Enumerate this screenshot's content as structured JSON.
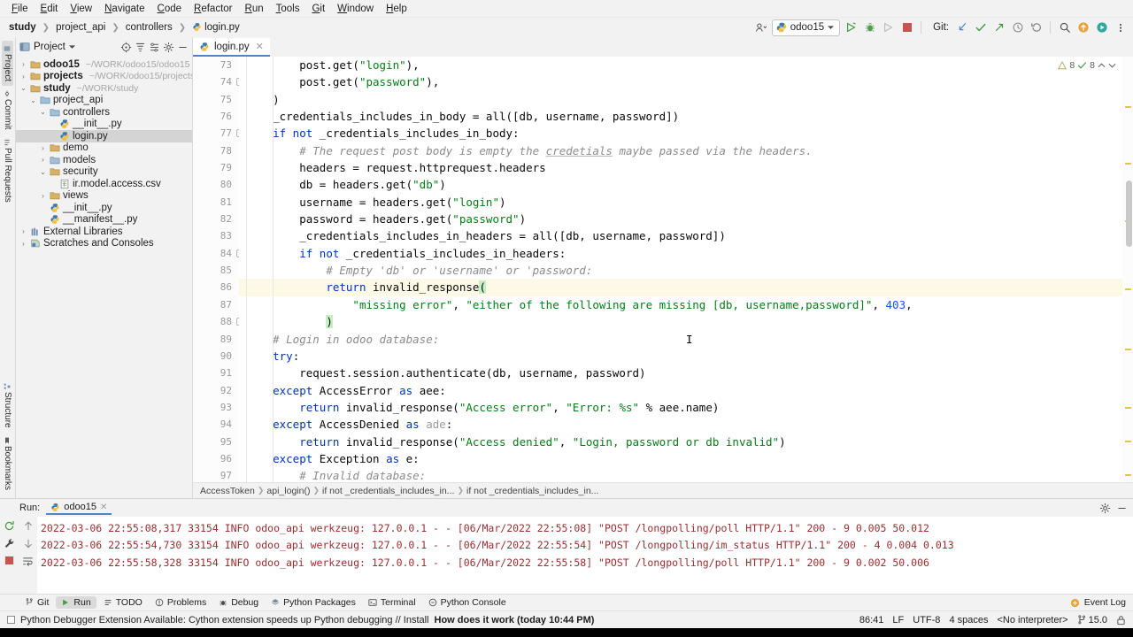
{
  "menu": {
    "items": [
      "File",
      "Edit",
      "View",
      "Navigate",
      "Code",
      "Refactor",
      "Run",
      "Tools",
      "Git",
      "Window",
      "Help"
    ]
  },
  "navbar": {
    "breadcrumbs": [
      "study",
      "project_api",
      "controllers",
      "login.py"
    ],
    "run_config": "odoo15",
    "git_label": "Git:"
  },
  "project_panel": {
    "title": "Project",
    "tree": [
      {
        "indent": 0,
        "arrow": "›",
        "label": "odoo15",
        "bold": true,
        "path": "~/WORK/odoo15/odoo15",
        "icon": "folder-icon",
        "selected": false
      },
      {
        "indent": 0,
        "arrow": "›",
        "label": "projects",
        "bold": true,
        "path": "~/WORK/odoo15/projects",
        "icon": "folder-icon",
        "selected": false
      },
      {
        "indent": 0,
        "arrow": "⌄",
        "label": "study",
        "bold": true,
        "path": "~/WORK/study",
        "icon": "folder-icon",
        "selected": false
      },
      {
        "indent": 1,
        "arrow": "⌄",
        "label": "project_api",
        "bold": false,
        "path": "",
        "icon": "module-folder-icon",
        "selected": false
      },
      {
        "indent": 2,
        "arrow": "⌄",
        "label": "controllers",
        "bold": false,
        "path": "",
        "icon": "module-folder-icon",
        "selected": false
      },
      {
        "indent": 3,
        "arrow": "",
        "label": "__init__.py",
        "bold": false,
        "path": "",
        "icon": "python-file-icon",
        "selected": false
      },
      {
        "indent": 3,
        "arrow": "",
        "label": "login.py",
        "bold": false,
        "path": "",
        "icon": "python-file-icon",
        "selected": true
      },
      {
        "indent": 2,
        "arrow": "›",
        "label": "demo",
        "bold": false,
        "path": "",
        "icon": "folder-icon",
        "selected": false
      },
      {
        "indent": 2,
        "arrow": "›",
        "label": "models",
        "bold": false,
        "path": "",
        "icon": "module-folder-icon",
        "selected": false
      },
      {
        "indent": 2,
        "arrow": "⌄",
        "label": "security",
        "bold": false,
        "path": "",
        "icon": "folder-icon",
        "selected": false
      },
      {
        "indent": 3,
        "arrow": "",
        "label": "ir.model.access.csv",
        "bold": false,
        "path": "",
        "icon": "csv-file-icon",
        "selected": false
      },
      {
        "indent": 2,
        "arrow": "›",
        "label": "views",
        "bold": false,
        "path": "",
        "icon": "folder-icon",
        "selected": false
      },
      {
        "indent": 2,
        "arrow": "",
        "label": "__init__.py",
        "bold": false,
        "path": "",
        "icon": "python-file-icon",
        "selected": false
      },
      {
        "indent": 2,
        "arrow": "",
        "label": "__manifest__.py",
        "bold": false,
        "path": "",
        "icon": "python-file-icon",
        "selected": false
      },
      {
        "indent": 0,
        "arrow": "›",
        "label": "External Libraries",
        "bold": false,
        "path": "",
        "icon": "library-icon",
        "selected": false
      },
      {
        "indent": 0,
        "arrow": "›",
        "label": "Scratches and Consoles",
        "bold": false,
        "path": "",
        "icon": "scratch-icon",
        "selected": false
      }
    ]
  },
  "left_strip": {
    "top_tabs": [
      "Project",
      "Commit",
      "Pull Requests"
    ],
    "bottom_tabs": [
      "Structure",
      "Bookmarks"
    ]
  },
  "editor": {
    "tab_label": "login.py",
    "inspection": {
      "warning_count": "8",
      "ok_count": "8"
    },
    "first_line": 73,
    "lines": [
      {
        "num": 73,
        "fold": "",
        "html": "        post.get(<span class=\"s\">\"login\"</span>),"
      },
      {
        "num": 74,
        "fold": "up",
        "html": "        post.get(<span class=\"s\">\"password\"</span>),"
      },
      {
        "num": 75,
        "fold": "",
        "html": "    )"
      },
      {
        "num": 76,
        "fold": "",
        "html": "    _credentials_includes_in_body = all([db, username, password])"
      },
      {
        "num": 77,
        "fold": "down",
        "html": "    <span class=\"k\">if not</span> _credentials_includes_in_body:"
      },
      {
        "num": 78,
        "fold": "",
        "html": "        <span class=\"c\"># The request post body is empty the <span class=\"sp\">credetials</span> maybe passed via the headers.</span>"
      },
      {
        "num": 79,
        "fold": "",
        "html": "        headers = request.httprequest.headers"
      },
      {
        "num": 80,
        "fold": "",
        "html": "        db = headers.get(<span class=\"s\">\"db\"</span>)"
      },
      {
        "num": 81,
        "fold": "",
        "html": "        username = headers.get(<span class=\"s\">\"login\"</span>)"
      },
      {
        "num": 82,
        "fold": "",
        "html": "        password = headers.get(<span class=\"s\">\"password\"</span>)"
      },
      {
        "num": 83,
        "fold": "",
        "html": "        _credentials_includes_in_headers = all([db, username, password])"
      },
      {
        "num": 84,
        "fold": "down",
        "html": "        <span class=\"k\">if not</span> _credentials_includes_in_headers:"
      },
      {
        "num": 85,
        "fold": "",
        "html": "            <span class=\"c\"># Empty 'db' or 'username' or 'password:</span>"
      },
      {
        "num": 86,
        "fold": "",
        "hl": true,
        "html": "            <span class=\"k\">return</span> invalid_response<span class=\"br\">(</span>"
      },
      {
        "num": 87,
        "fold": "",
        "html": "                <span class=\"s\">\"missing error\"</span>, <span class=\"s\">\"either of the following are missing [db, username,password]\"</span>, <span class=\"n\">403</span>,"
      },
      {
        "num": 88,
        "fold": "up",
        "html": "            <span class=\"br\">)</span>"
      },
      {
        "num": 89,
        "fold": "",
        "html": "    <span class=\"c\"># Login in odoo database:</span>"
      },
      {
        "num": 90,
        "fold": "",
        "html": "    <span class=\"k\">try</span>:"
      },
      {
        "num": 91,
        "fold": "",
        "html": "        request.session.authenticate(db, username, password)"
      },
      {
        "num": 92,
        "fold": "",
        "html": "    <span class=\"k\">except</span> AccessError <span class=\"k\">as</span> aee:"
      },
      {
        "num": 93,
        "fold": "",
        "html": "        <span class=\"k\">return</span> invalid_response(<span class=\"s\">\"Access error\"</span>, <span class=\"s\">\"Error: %s\"</span> % aee.name)"
      },
      {
        "num": 94,
        "fold": "",
        "html": "    <span class=\"k\">except</span> AccessDenied <span class=\"k\">as</span> <span class=\"g\">ade</span>:"
      },
      {
        "num": 95,
        "fold": "",
        "html": "        <span class=\"k\">return</span> invalid_response(<span class=\"s\">\"Access denied\"</span>, <span class=\"s\">\"Login, password or db invalid\"</span>)"
      },
      {
        "num": 96,
        "fold": "",
        "html": "    <span class=\"k\">except</span> Exception <span class=\"k\">as</span> e:"
      },
      {
        "num": 97,
        "fold": "",
        "html": "        <span class=\"c\"># Invalid database:</span>"
      }
    ],
    "structure_crumbs": [
      "AccessToken",
      "api_login()",
      "if not _credentials_includes_in...",
      "if not _credentials_includes_in..."
    ]
  },
  "run_panel": {
    "label": "Run:",
    "tab": "odoo15",
    "log_lines": [
      "2022-03-06 22:55:08,317 33154 INFO odoo_api werkzeug: 127.0.0.1 - - [06/Mar/2022 22:55:08] \"POST /longpolling/poll HTTP/1.1\" 200 - 9 0.005 50.012",
      "2022-03-06 22:55:54,730 33154 INFO odoo_api werkzeug: 127.0.0.1 - - [06/Mar/2022 22:55:54] \"POST /longpolling/im_status HTTP/1.1\" 200 - 4 0.004 0.013",
      "2022-03-06 22:55:58,328 33154 INFO odoo_api werkzeug: 127.0.0.1 - - [06/Mar/2022 22:55:58] \"POST /longpolling/poll HTTP/1.1\" 200 - 9 0.002 50.006"
    ]
  },
  "toolwindow_bar": {
    "items": [
      {
        "label": "Git",
        "icon": "git-branch-icon",
        "selected": false
      },
      {
        "label": "Run",
        "icon": "run-icon",
        "selected": true
      },
      {
        "label": "TODO",
        "icon": "todo-icon",
        "selected": false
      },
      {
        "label": "Problems",
        "icon": "problems-icon",
        "selected": false
      },
      {
        "label": "Debug",
        "icon": "debug-icon",
        "selected": false
      },
      {
        "label": "Python Packages",
        "icon": "packages-icon",
        "selected": false
      },
      {
        "label": "Terminal",
        "icon": "terminal-icon",
        "selected": false
      },
      {
        "label": "Python Console",
        "icon": "python-console-icon",
        "selected": false
      }
    ],
    "event_log": "Event Log"
  },
  "statusbar": {
    "notification": "Python Debugger Extension Available: Cython extension speeds up Python debugging // Install",
    "notification_link": "How does it work (today 10:44 PM)",
    "caret_position": "86:41",
    "line_separator": "LF",
    "encoding": "UTF-8",
    "indent": "4 spaces",
    "interpreter": "<No interpreter>",
    "branch": "15.0"
  },
  "colors": {
    "accent": "#4a86c8",
    "keyword": "#0033b3",
    "string": "#067d17",
    "number": "#1750eb",
    "comment": "#8c8c8c",
    "console_text": "#9b2d30",
    "current_line": "#fcfae6",
    "selection": "#d4d4d4"
  }
}
